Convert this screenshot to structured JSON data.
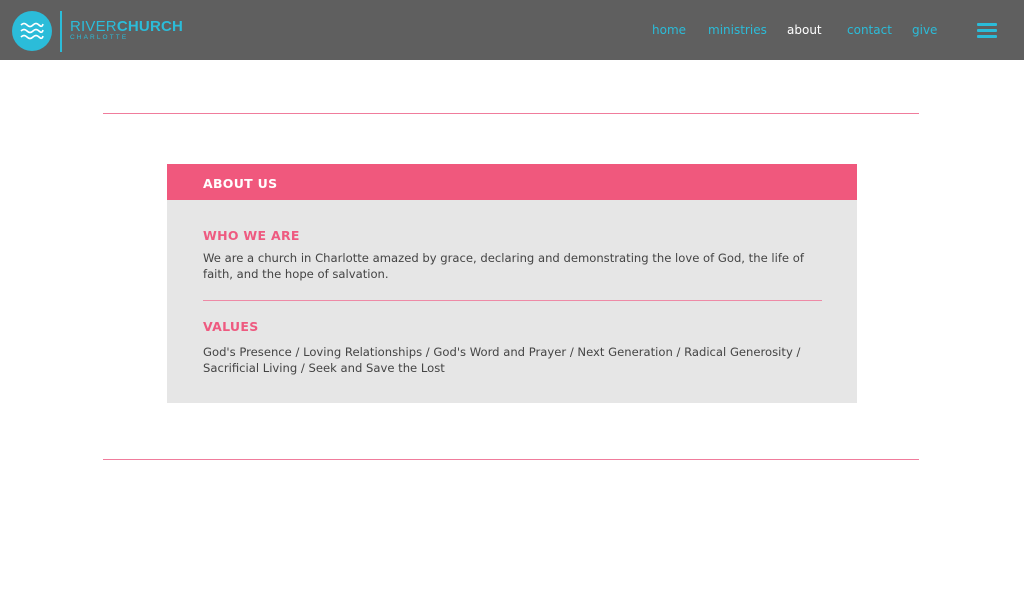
{
  "brand": {
    "name_light": "RIVER",
    "name_bold": "CHURCH",
    "subtitle": "CHARLOTTE",
    "accent_color": "#2bbcd9",
    "icon": "waves-icon"
  },
  "nav": {
    "items": [
      {
        "label": "home",
        "active": false
      },
      {
        "label": "ministries",
        "active": false
      },
      {
        "label": "about",
        "active": true
      },
      {
        "label": "contact",
        "active": false
      },
      {
        "label": "give",
        "active": false
      }
    ],
    "menu_icon": "hamburger-menu-icon"
  },
  "about_card": {
    "header": "ABOUT US",
    "header_color": "#f0587d",
    "sections": [
      {
        "title": "WHO WE ARE",
        "body": "We are a church in Charlotte amazed by grace, declaring and demonstrating the love of God, the life of faith, and the hope of salvation."
      },
      {
        "title": "VALUES",
        "body": "God's Presence / Loving Relationships / God's Word and Prayer / Next Generation / Radical Generosity / Sacrificial Living / Seek and Save the Lost"
      }
    ]
  }
}
